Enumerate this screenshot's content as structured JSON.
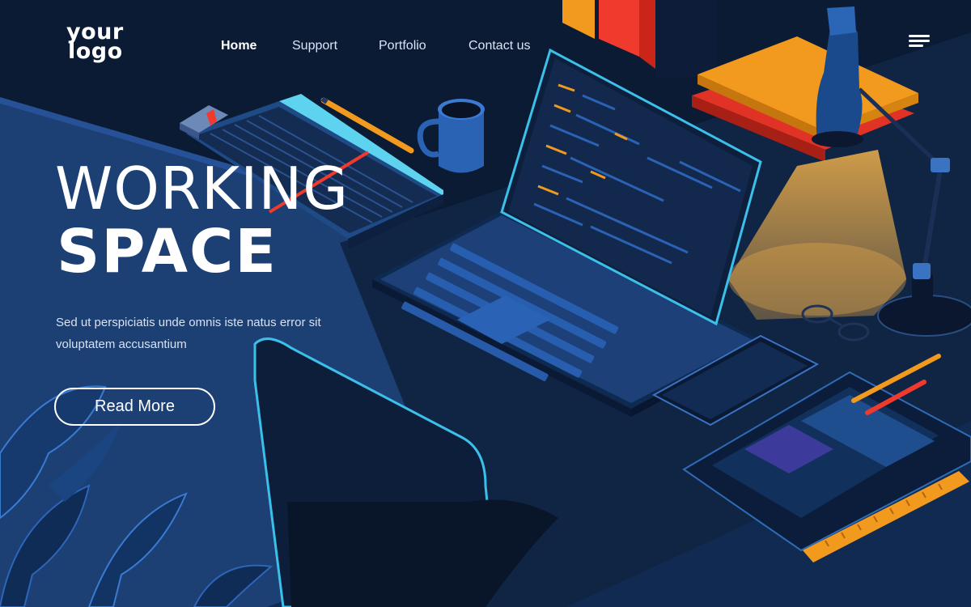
{
  "logo": {
    "line1": "your",
    "line2": "logo"
  },
  "nav": {
    "items": [
      {
        "label": "Home",
        "active": true
      },
      {
        "label": "Support",
        "active": false
      },
      {
        "label": "Portfolio",
        "active": false
      },
      {
        "label": "Contact us",
        "active": false
      }
    ],
    "menu_icon": "hamburger-menu-icon"
  },
  "hero": {
    "title_line1": "WORKING",
    "title_line2": "SPACE",
    "subtitle": "Sed ut perspiciatis unde omnis iste natus error sit voluptatem accusantium",
    "cta_label": "Read More"
  },
  "colors": {
    "background": "#0c1b34",
    "desk": "#1c3f74",
    "desk_edge": "#15315e",
    "accent_orange": "#f19a1e",
    "accent_red": "#f03a2e",
    "accent_cyan": "#45c8f0",
    "lamp_glow": "#f0b04a"
  }
}
